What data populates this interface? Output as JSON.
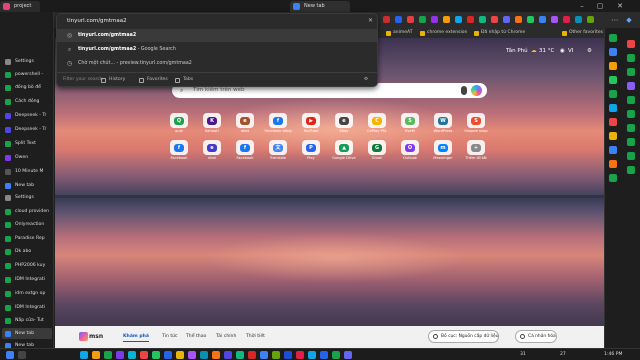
{
  "window": {
    "tab_project": "project",
    "tab_new": "New tab"
  },
  "toolbar": {
    "address_value": "tinyurl.com/gmtmaa2"
  },
  "favorites": [
    "animeAT",
    "chrome extension",
    "Đã nhập từ Chrome",
    "Other favorites"
  ],
  "sidebar": {
    "items": [
      "Settings",
      "powershell -",
      "đống bò để",
      "Cách đóng",
      "Deepseek - Tr",
      "Deepseek - Tr",
      "Split Text",
      "Owen",
      "10 Minute M",
      "New tab",
      "Settings",
      "cloud providen",
      "Onlyreaction",
      "Paradise Rep",
      "Dk abo",
      "PHP2006 kuy",
      "IDM Integrati",
      "idm extgn op",
      "IDM Integrati",
      "Nấp cửa- Tut",
      "New tab",
      "New tab"
    ]
  },
  "omnibox": {
    "input": "tinyurl.com/gmtmaa2",
    "suggestions": [
      {
        "bold": "tinyurl.com/gmtmaa2",
        "rest": ""
      },
      {
        "bold": "tinyurl.com/gmtmaa2",
        "rest": " - Google Search"
      },
      {
        "bold": "",
        "rest": "Chờ một chút... - preview.tinyurl.com/gmtmaa2"
      }
    ],
    "filters": [
      "Filter your search",
      "History",
      "Favorites",
      "Tabs"
    ]
  },
  "weather": {
    "location": "Tân Phú",
    "temp": "31 °C",
    "user": "VI"
  },
  "search": {
    "placeholder": "Tìm kiếm trên web"
  },
  "quick_links_row1": [
    {
      "label": "quik",
      "color": "#17a34a",
      "glyph": "Q"
    },
    {
      "label": "Kahoot!",
      "color": "#46178f",
      "glyph": "K"
    },
    {
      "label": "ebot",
      "color": "#a0522d",
      "glyph": "e"
    },
    {
      "label": "Facebook bảng",
      "color": "#1877f2",
      "glyph": "f"
    },
    {
      "label": "YouTube",
      "color": "#e62117",
      "glyph": "▶"
    },
    {
      "label": "Ebay",
      "color": "#444444",
      "glyph": "e"
    },
    {
      "label": "ChPlay PSL",
      "color": "#f4b400",
      "glyph": "C"
    },
    {
      "label": "fiveM",
      "color": "#5cb85c",
      "glyph": "5"
    },
    {
      "label": "WordPress",
      "color": "#21759b",
      "glyph": "W"
    },
    {
      "label": "Shopee shop",
      "color": "#ee4d2d",
      "glyph": "S"
    }
  ],
  "quick_links_row2": [
    {
      "label": "Facebook",
      "color": "#1877f2",
      "glyph": "f"
    },
    {
      "label": "ebai",
      "color": "#4338ca",
      "glyph": "e"
    },
    {
      "label": "Facebook",
      "color": "#1877f2",
      "glyph": "f"
    },
    {
      "label": "Translate",
      "color": "#4285f4",
      "glyph": "文"
    },
    {
      "label": "Play",
      "color": "#2563eb",
      "glyph": "P"
    },
    {
      "label": "Google Drive",
      "color": "#0f9d58",
      "glyph": "▲"
    },
    {
      "label": "Gmail",
      "color": "#0b7a3b",
      "glyph": "G"
    },
    {
      "label": "Outlook",
      "color": "#7c3aed",
      "glyph": "O"
    },
    {
      "label": "Messenger",
      "color": "#0084ff",
      "glyph": "m"
    },
    {
      "label": "Thêm lối tắt",
      "color": "#888888",
      "glyph": "+"
    }
  ],
  "bottom": {
    "brand": "msn",
    "nav": [
      "Khám phá",
      "Tin tức",
      "Thể thao",
      "Tài chính",
      "Thời tiết"
    ],
    "feedback": "Bỏ cục: Nguồn cấp dữ liệu",
    "customize": "Cá nhân hóa"
  },
  "taskbar": {
    "time": "1:46 PM",
    "date": "27",
    "temp": "31"
  }
}
